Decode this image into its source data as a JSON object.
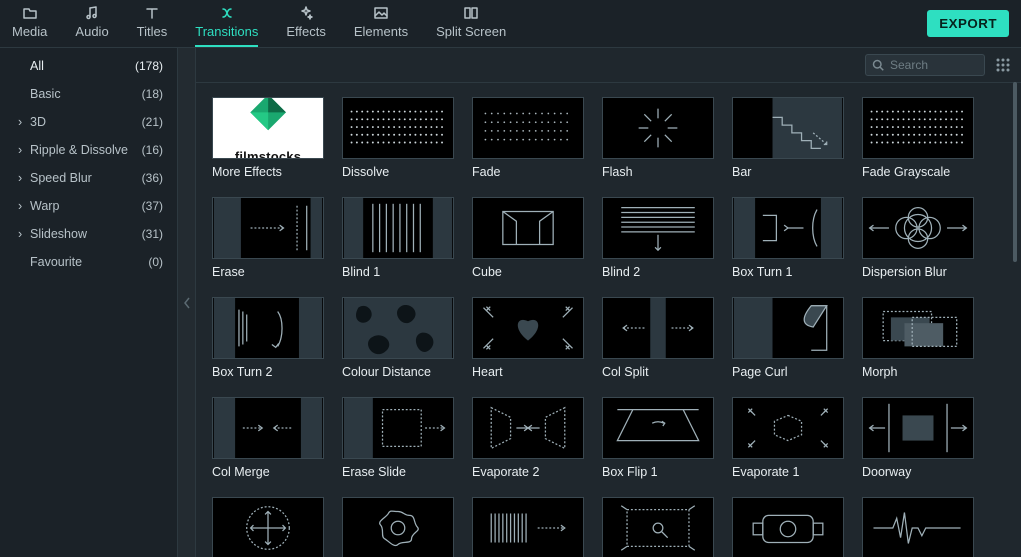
{
  "tabs": [
    {
      "id": "media",
      "label": "Media",
      "icon": "folder"
    },
    {
      "id": "audio",
      "label": "Audio",
      "icon": "music"
    },
    {
      "id": "titles",
      "label": "Titles",
      "icon": "text"
    },
    {
      "id": "transitions",
      "label": "Transitions",
      "icon": "swap",
      "active": true
    },
    {
      "id": "effects",
      "label": "Effects",
      "icon": "sparkle"
    },
    {
      "id": "elements",
      "label": "Elements",
      "icon": "image"
    },
    {
      "id": "splitscreen",
      "label": "Split Screen",
      "icon": "split"
    }
  ],
  "export_label": "EXPORT",
  "search": {
    "placeholder": "Search",
    "value": ""
  },
  "categories": [
    {
      "label": "All",
      "count": "(178)",
      "expandable": false,
      "selected": true
    },
    {
      "label": "Basic",
      "count": "(18)",
      "expandable": false
    },
    {
      "label": "3D",
      "count": "(21)",
      "expandable": true
    },
    {
      "label": "Ripple & Dissolve",
      "count": "(16)",
      "expandable": true
    },
    {
      "label": "Speed Blur",
      "count": "(36)",
      "expandable": true
    },
    {
      "label": "Warp",
      "count": "(37)",
      "expandable": true
    },
    {
      "label": "Slideshow",
      "count": "(31)",
      "expandable": true
    },
    {
      "label": "Favourite",
      "count": "(0)",
      "expandable": false
    }
  ],
  "items": [
    {
      "label": "More Effects",
      "thumb": "filmstocks",
      "brand": "filmstocks"
    },
    {
      "label": "Dissolve",
      "thumb": "dots"
    },
    {
      "label": "Fade",
      "thumb": "dots-sparse"
    },
    {
      "label": "Flash",
      "thumb": "burst"
    },
    {
      "label": "Bar",
      "thumb": "stairs"
    },
    {
      "label": "Fade Grayscale",
      "thumb": "dots"
    },
    {
      "label": "Erase",
      "thumb": "erase"
    },
    {
      "label": "Blind 1",
      "thumb": "blind-v"
    },
    {
      "label": "Cube",
      "thumb": "cube"
    },
    {
      "label": "Blind 2",
      "thumb": "blind-h"
    },
    {
      "label": "Box Turn 1",
      "thumb": "boxturn1"
    },
    {
      "label": "Dispersion Blur",
      "thumb": "dispersion"
    },
    {
      "label": "Box Turn 2",
      "thumb": "boxturn2"
    },
    {
      "label": "Colour Distance",
      "thumb": "blobs"
    },
    {
      "label": "Heart",
      "thumb": "heart"
    },
    {
      "label": "Col Split",
      "thumb": "colsplit"
    },
    {
      "label": "Page Curl",
      "thumb": "pagecurl"
    },
    {
      "label": "Morph",
      "thumb": "morph"
    },
    {
      "label": "Col Merge",
      "thumb": "colmerge"
    },
    {
      "label": "Erase Slide",
      "thumb": "eraseslide"
    },
    {
      "label": "Evaporate 2",
      "thumb": "evap2"
    },
    {
      "label": "Box Flip 1",
      "thumb": "boxflip"
    },
    {
      "label": "Evaporate 1",
      "thumb": "evap1"
    },
    {
      "label": "Doorway",
      "thumb": "doorway"
    },
    {
      "label": "",
      "thumb": "cross-arrows"
    },
    {
      "label": "",
      "thumb": "gear-blob"
    },
    {
      "label": "",
      "thumb": "barcode"
    },
    {
      "label": "",
      "thumb": "zoom-rect"
    },
    {
      "label": "",
      "thumb": "camera"
    },
    {
      "label": "",
      "thumb": "wave"
    }
  ]
}
